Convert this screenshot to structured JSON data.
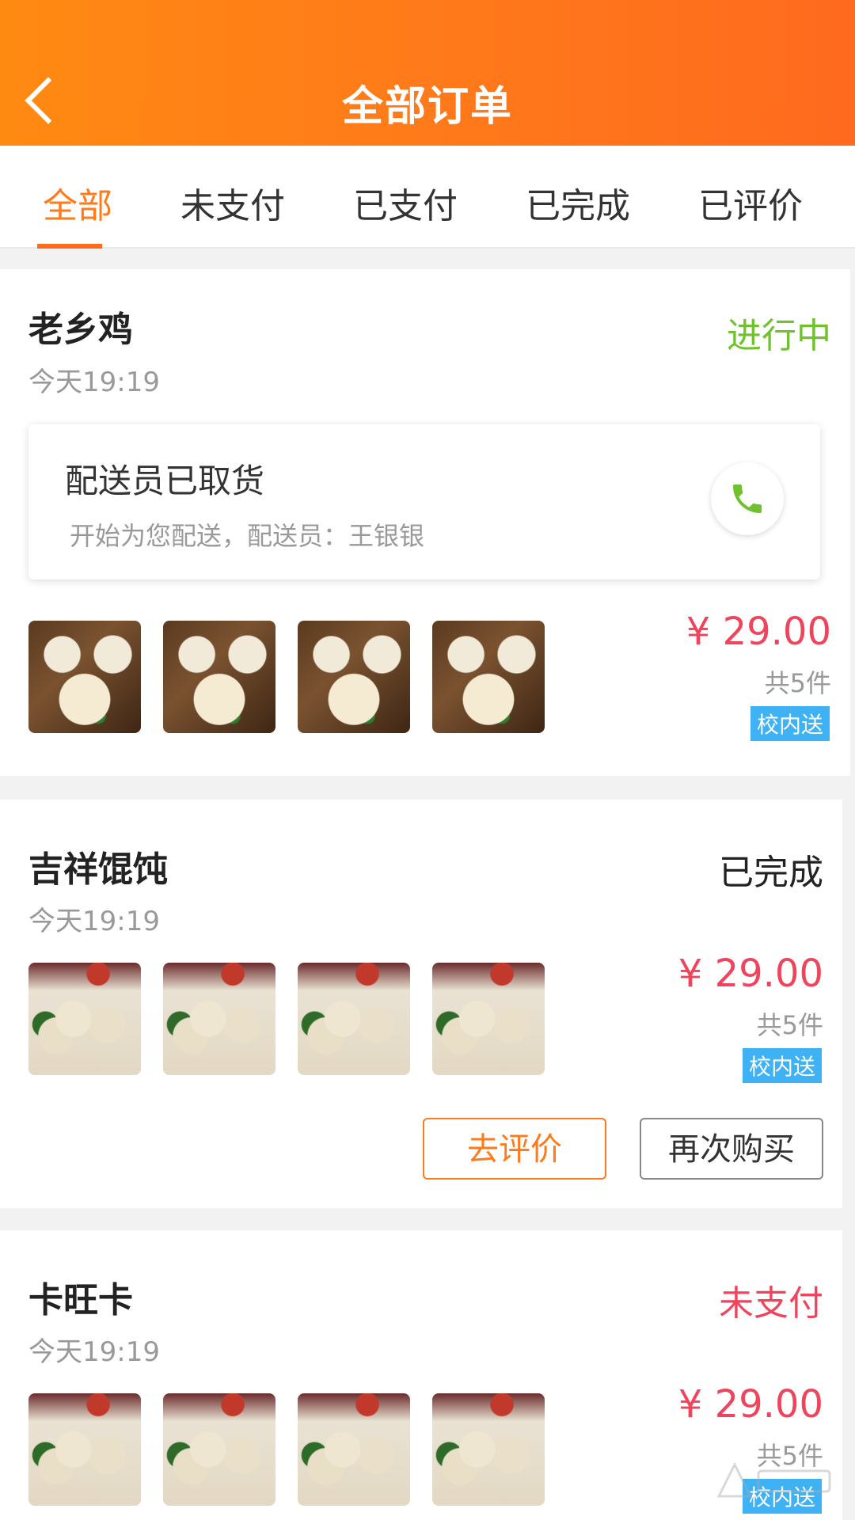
{
  "header": {
    "title": "全部订单"
  },
  "tabs": [
    {
      "label": "全部",
      "active": true
    },
    {
      "label": "未支付"
    },
    {
      "label": "已支付"
    },
    {
      "label": "已完成"
    },
    {
      "label": "已评价"
    }
  ],
  "orders": [
    {
      "shop": "老乡鸡",
      "time": "今天19:19",
      "status": "进行中",
      "delivery": {
        "title": "配送员已取货",
        "subtitle": "开始为您配送，配送员：王银银"
      },
      "price": "¥ 29.00",
      "count": "共5件",
      "tag": "校内送"
    },
    {
      "shop": "吉祥馄饨",
      "time": "今天19:19",
      "status": "已完成",
      "price": "¥ 29.00",
      "count": "共5件",
      "tag": "校内送",
      "buttons": {
        "review": "去评价",
        "rebuy": "再次购买"
      }
    },
    {
      "shop": "卡旺卡",
      "time": "今天19:19",
      "status": "未支付",
      "price": "¥ 29.00",
      "count": "共5件",
      "tag": "校内送"
    }
  ],
  "colors": {
    "accent": "#ff7a1a",
    "status_active": "#6fc22d",
    "status_unpaid": "#f0445d",
    "price": "#f0445d",
    "tag": "#3eb2f5"
  }
}
